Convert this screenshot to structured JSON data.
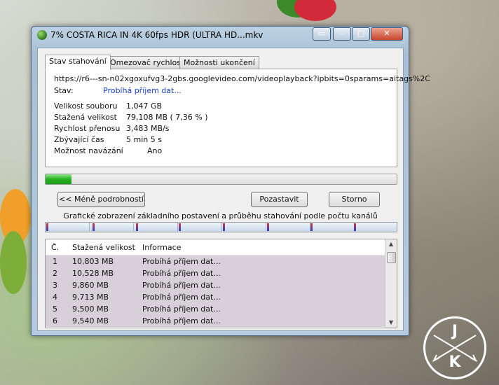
{
  "window": {
    "title": "7% COSTA RICA IN 4K 60fps HDR (ULTRA HD...mkv"
  },
  "tabs": [
    {
      "label": "Stav stahování",
      "active": true
    },
    {
      "label": "Omezovač rychlosti",
      "active": false
    },
    {
      "label": "Možnosti ukončení",
      "active": false
    }
  ],
  "status": {
    "url": "https://r6---sn-n02xgoxufvg3-2gbs.googlevideo.com/videoplayback?ipbits=0sparams=aitags%2C",
    "state_label": "Stav:",
    "state_value": "Probíhá příjem dat...",
    "file_size_label": "Velikost souboru",
    "file_size_value": "1,047  GB",
    "downloaded_label": "Stažená velikost",
    "downloaded_value": "79,108  MB  ( 7,36 % )",
    "speed_label": "Rychlost přenosu",
    "speed_value": "3,483  MB/s",
    "remaining_label": "Zbývající čas",
    "remaining_value": "5 min 5 s",
    "resume_label": "Možnost navázání",
    "resume_value": "Ano"
  },
  "progress_percent": 7.36,
  "buttons": {
    "less_details": "<< Méně podrobností",
    "pause": "Pozastavit",
    "cancel": "Storno"
  },
  "channels_caption": "Grafické zobrazení základního postavení a průběhu stahování podle počtu kanálů",
  "table": {
    "columns": [
      "Č.",
      "Stažená velikost",
      "Informace"
    ],
    "rows": [
      {
        "n": "1",
        "size": "10,803  MB",
        "info": "Probíhá příjem dat..."
      },
      {
        "n": "2",
        "size": "10,528  MB",
        "info": "Probíhá příjem dat..."
      },
      {
        "n": "3",
        "size": "9,860  MB",
        "info": "Probíhá příjem dat..."
      },
      {
        "n": "4",
        "size": "9,713  MB",
        "info": "Probíhá příjem dat..."
      },
      {
        "n": "5",
        "size": "9,500  MB",
        "info": "Probíhá příjem dat..."
      },
      {
        "n": "6",
        "size": "9,540  MB",
        "info": "Probíhá příjem dat..."
      }
    ]
  },
  "logo": {
    "top_letter": "J",
    "bottom_letter": "K"
  },
  "colors": {
    "progress_fill": "#27b11f",
    "status_value": "#1a3ccc",
    "row_background": "#d7d0d8"
  }
}
